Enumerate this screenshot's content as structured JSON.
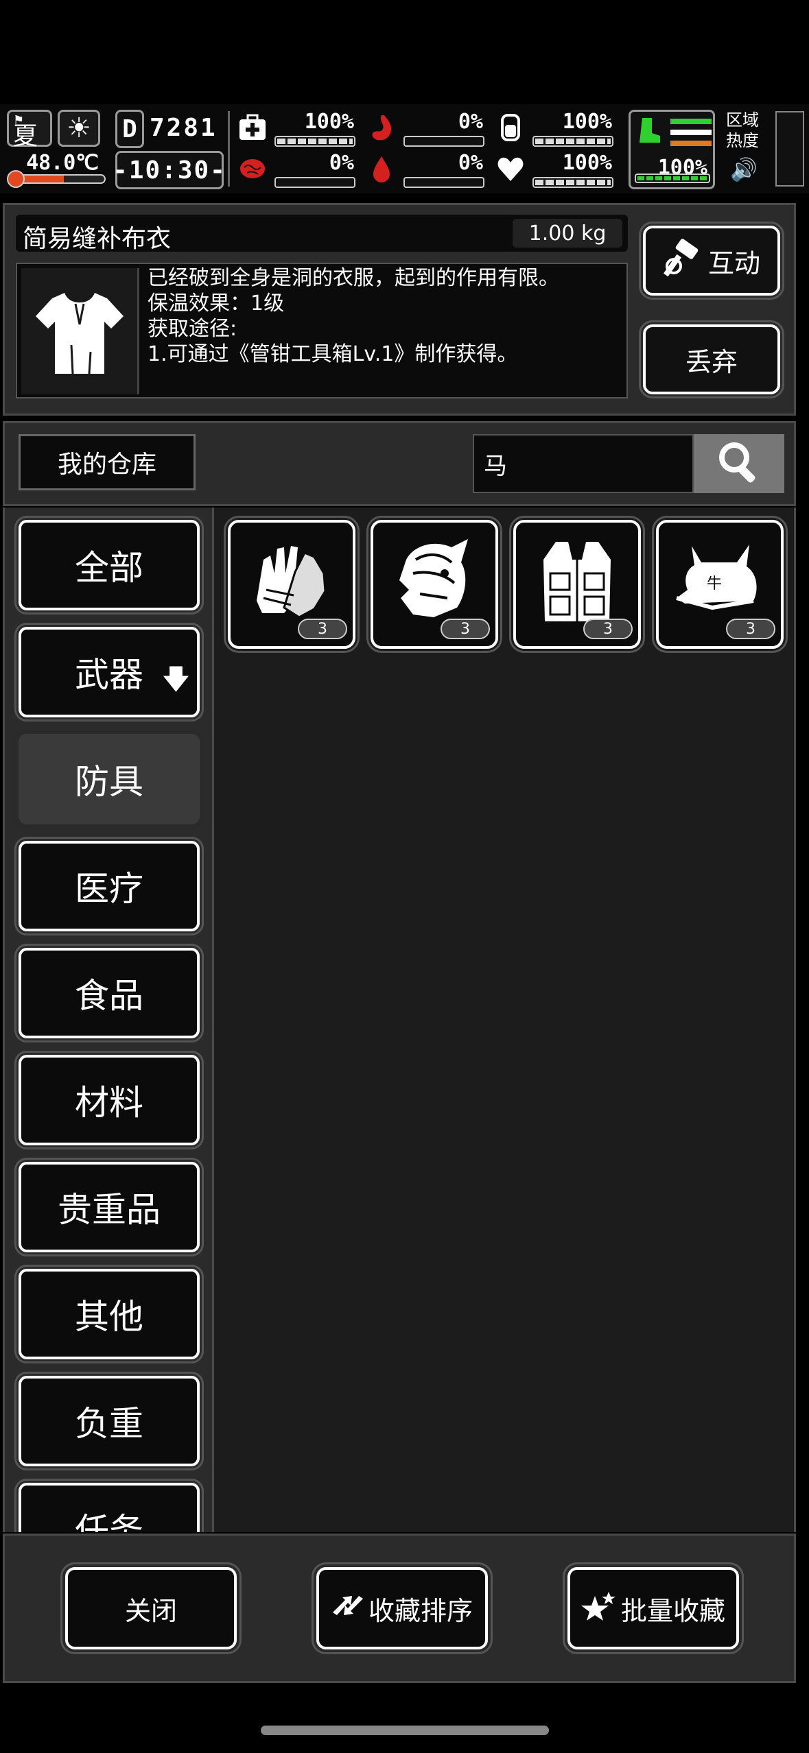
{
  "hud": {
    "season": "夏",
    "temperature": "48.0℃",
    "temperature_level": 0.55,
    "day_icon": "D",
    "day_number": "7281",
    "time": "-10:30-",
    "stats": [
      {
        "name": "medkit",
        "icon": "medkit-icon",
        "value": "100%"
      },
      {
        "name": "stomach",
        "icon": "stomach-icon",
        "value": "0%"
      },
      {
        "name": "water",
        "icon": "water-bottle-icon",
        "value": "100%"
      },
      {
        "name": "brain",
        "icon": "brain-icon",
        "value": "0%"
      },
      {
        "name": "blood",
        "icon": "blood-drop-icon",
        "value": "0%"
      },
      {
        "name": "heart",
        "icon": "heart-icon",
        "value": "100%"
      }
    ],
    "stamina_value": "100%",
    "area_label": "区域热度",
    "colors": {
      "temp": "#e1491f",
      "stamina": "#2fd12f",
      "danger": "#d62020",
      "line_orange": "#e07a1f"
    }
  },
  "item": {
    "name": "简易缝补布衣",
    "weight": "1.00 kg",
    "description_lines": [
      "已经破到全身是洞的衣服，起到的作用有限。",
      "保温效果：1级",
      "获取途径:",
      "1.可通过《管钳工具箱Lv.1》制作获得。"
    ],
    "interact_label": "互动",
    "discard_label": "丢弃"
  },
  "search": {
    "warehouse_label": "我的仓库",
    "value": "马"
  },
  "categories": [
    {
      "label": "全部"
    },
    {
      "label": "武器",
      "arrow": "🡇"
    },
    {
      "label": "防具",
      "active": true
    },
    {
      "label": "医疗"
    },
    {
      "label": "食品"
    },
    {
      "label": "材料"
    },
    {
      "label": "贵重品"
    },
    {
      "label": "其他"
    },
    {
      "label": "负重"
    },
    {
      "label": "任务"
    }
  ],
  "items": [
    {
      "icon": "gloves-icon",
      "count": "3"
    },
    {
      "icon": "horse-helmet-icon",
      "count": "3"
    },
    {
      "icon": "vest-icon",
      "count": "3"
    },
    {
      "icon": "ox-cap-icon",
      "count": "3"
    }
  ],
  "footer": {
    "close_label": "关闭",
    "sort_label": "收藏排序",
    "batch_label": "批量收藏"
  }
}
